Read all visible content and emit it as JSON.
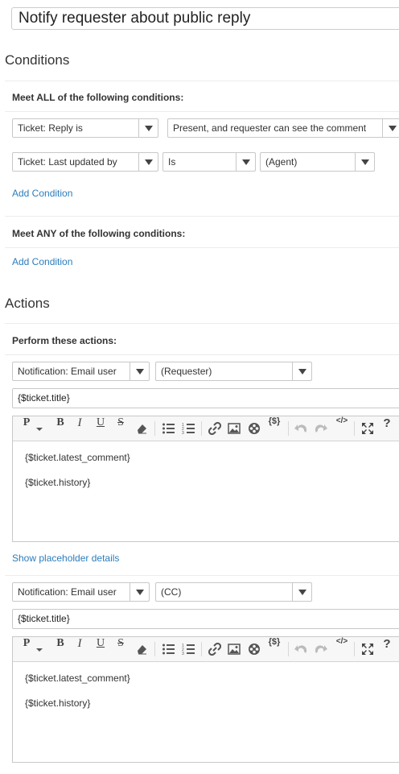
{
  "trigger_title": "Notify requester about public reply",
  "conditions": {
    "heading": "Conditions",
    "all_label": "Meet ALL of the following conditions:",
    "all_rows": [
      {
        "field": "Ticket: Reply is",
        "value": "Present, and requester can see the comment"
      },
      {
        "field": "Ticket: Last updated by",
        "operator": "Is",
        "value": "(Agent)"
      }
    ],
    "add_condition_all": "Add Condition",
    "any_label": "Meet ANY of the following conditions:",
    "add_condition_any": "Add Condition"
  },
  "actions": {
    "heading": "Actions",
    "perform_label": "Perform these actions:",
    "items": [
      {
        "action": "Notification: Email user",
        "recipient": "(Requester)",
        "subject": "{$ticket.title}",
        "body_lines": [
          "{$ticket.latest_comment}",
          "{$ticket.history}"
        ]
      },
      {
        "action": "Notification: Email user",
        "recipient": "(CC)",
        "subject": "{$ticket.title}",
        "body_lines": [
          "{$ticket.latest_comment}",
          "{$ticket.history}"
        ]
      }
    ],
    "show_placeholder_details": "Show placeholder details"
  },
  "toolbar": {
    "paragraph": "P",
    "bold": "B",
    "italic": "I",
    "underline": "U",
    "strike": "S",
    "placeholder": "{$}",
    "code": "</>",
    "help": "?",
    "icons": [
      "paragraph-format-icon",
      "bold-icon",
      "italic-icon",
      "underline-icon",
      "strikethrough-icon",
      "clear-format-icon",
      "bulleted-list-icon",
      "numbered-list-icon",
      "link-icon",
      "image-icon",
      "media-icon",
      "placeholder-icon",
      "undo-icon",
      "redo-icon",
      "source-code-icon",
      "fullscreen-icon",
      "help-icon"
    ]
  }
}
